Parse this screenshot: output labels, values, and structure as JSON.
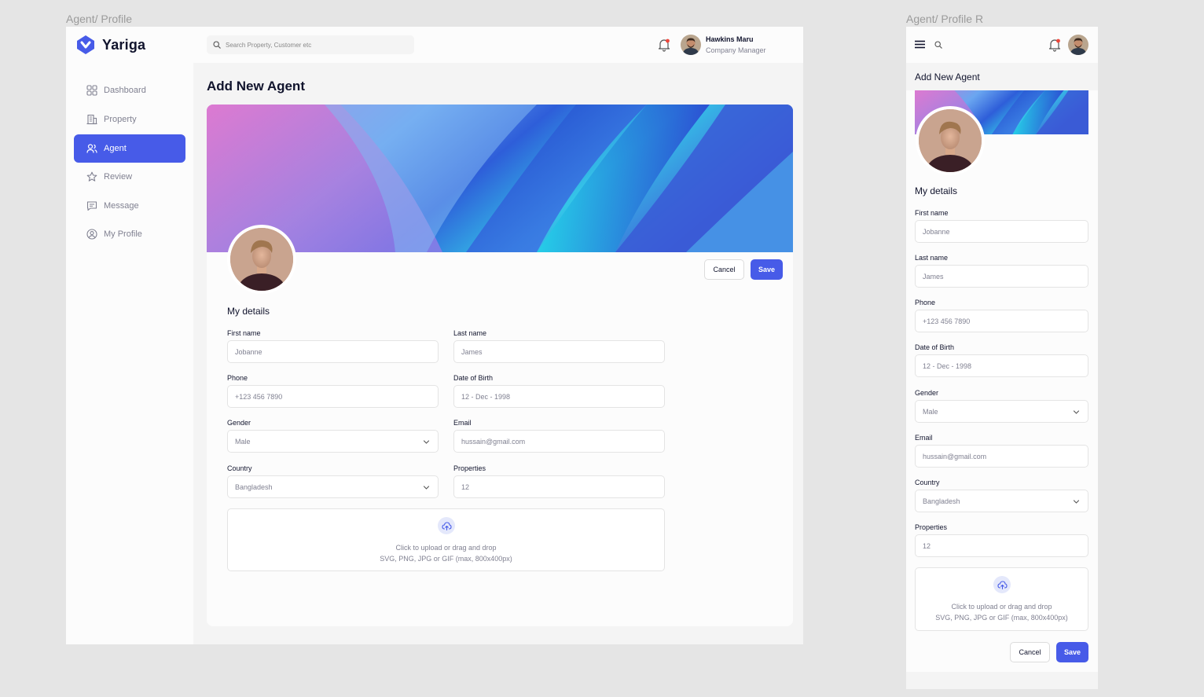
{
  "frames": {
    "desktop_label": "Agent/ Profile",
    "mobile_label": "Agent/ Profile R"
  },
  "app": {
    "name": "Yariga",
    "brand_color": "#475be8"
  },
  "search": {
    "placeholder": "Search Property, Customer etc"
  },
  "user": {
    "name": "Hawkins Maru",
    "role": "Company Manager"
  },
  "sidebar": {
    "items": [
      {
        "label": "Dashboard",
        "icon": "dashboard-grid-icon",
        "active": false
      },
      {
        "label": "Property",
        "icon": "building-icon",
        "active": false
      },
      {
        "label": "Agent",
        "icon": "users-icon",
        "active": true
      },
      {
        "label": "Review",
        "icon": "star-icon",
        "active": false
      },
      {
        "label": "Message",
        "icon": "chat-icon",
        "active": false
      },
      {
        "label": "My Profile",
        "icon": "user-circle-icon",
        "active": false
      }
    ]
  },
  "page": {
    "title": "Add New Agent",
    "section_title": "My details"
  },
  "actions": {
    "cancel": "Cancel",
    "save": "Save"
  },
  "form": {
    "first_name": {
      "label": "First name",
      "value": "Jobanne"
    },
    "last_name": {
      "label": "Last name",
      "value": "James"
    },
    "phone": {
      "label": "Phone",
      "value": "+123 456 7890"
    },
    "dob": {
      "label": "Date of Birth",
      "value": "12 - Dec - 1998"
    },
    "gender": {
      "label": "Gender",
      "value": "Male"
    },
    "email": {
      "label": "Email",
      "value": "hussain@gmail.com"
    },
    "country": {
      "label": "Country",
      "value": "Bangladesh"
    },
    "properties": {
      "label": "Properties",
      "value": "12"
    }
  },
  "upload": {
    "line1": "Click to upload or drag and drop",
    "line2": "SVG, PNG, JPG or GIF (max, 800x400px)"
  }
}
